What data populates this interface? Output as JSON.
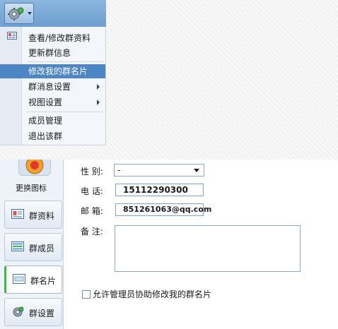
{
  "menu": {
    "items": [
      {
        "label": "查看/修改群资料"
      },
      {
        "label": "更新群信息"
      },
      {
        "label": "修改我的群名片"
      },
      {
        "label": "群消息设置"
      },
      {
        "label": "视图设置"
      },
      {
        "label": "成员管理"
      },
      {
        "label": "退出该群"
      }
    ],
    "highlighted_item": "修改我的群名片"
  },
  "sidebar": {
    "change_icon_label": "更换图标",
    "nav": [
      {
        "label": "群资料",
        "icon": "group-info-icon"
      },
      {
        "label": "群成员",
        "icon": "members-icon"
      },
      {
        "label": "群名片",
        "icon": "card-icon",
        "active": true
      },
      {
        "label": "群设置",
        "icon": "settings-icon"
      }
    ]
  },
  "form": {
    "gender_label": "性  别:",
    "gender_value": "-",
    "phone_label": "电  话:",
    "phone_value": "15112290300",
    "email_label": "邮  箱:",
    "email_value": "851261063@qq.com",
    "note_label": "备  注:",
    "note_value": "",
    "allow_admin_label": "允许管理员协助修改我的群名片",
    "allow_admin_checked": false
  },
  "colors": {
    "toolbar": "#7aa9d8",
    "menu_highlight": "#4d86c4",
    "active_nav_accent": "#3fb54a"
  }
}
